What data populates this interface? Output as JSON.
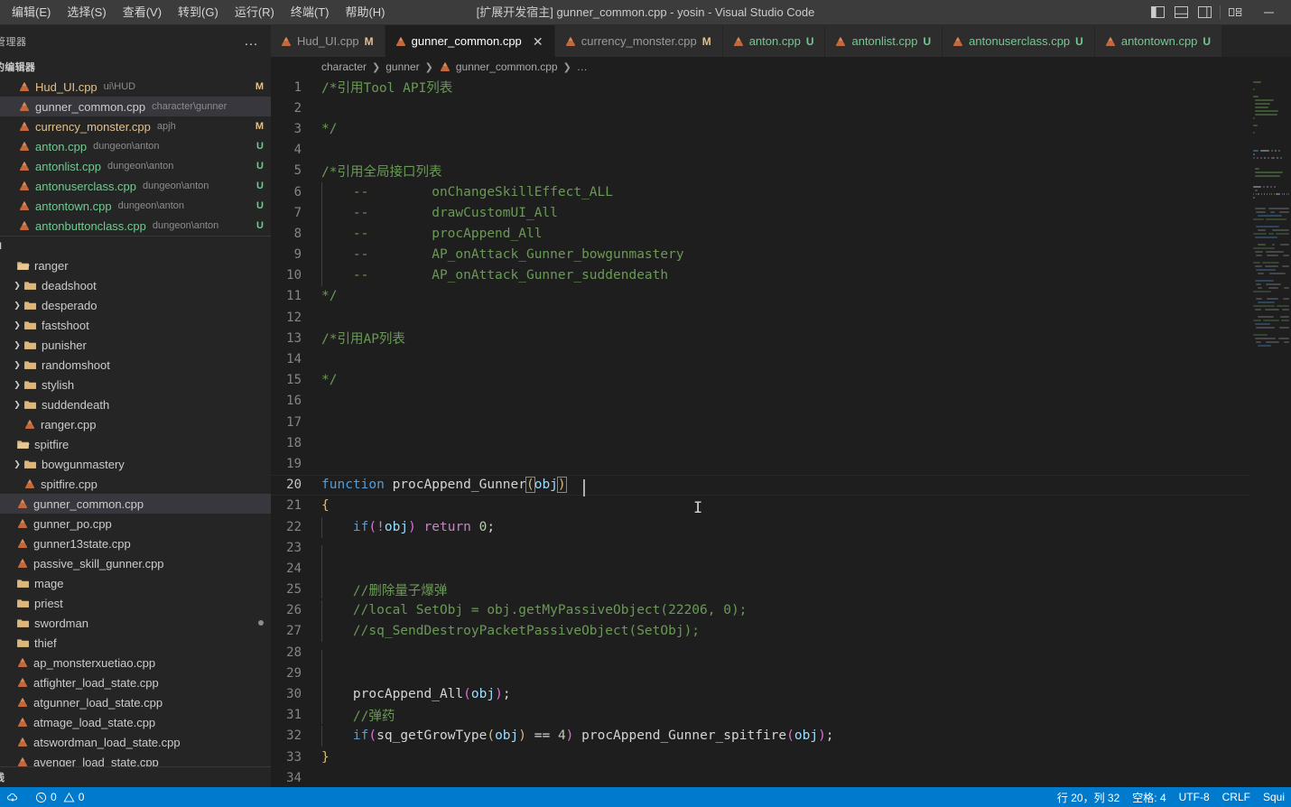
{
  "window": {
    "title": "[扩展开发宿主] gunner_common.cpp - yosin - Visual Studio Code",
    "minimize_label": "—"
  },
  "menubar": {
    "items": [
      {
        "label": "编辑(E)",
        "name": "menu-edit"
      },
      {
        "label": "选择(S)",
        "name": "menu-select"
      },
      {
        "label": "查看(V)",
        "name": "menu-view"
      },
      {
        "label": "转到(G)",
        "name": "menu-goto"
      },
      {
        "label": "运行(R)",
        "name": "menu-run"
      },
      {
        "label": "终端(T)",
        "name": "menu-terminal"
      },
      {
        "label": "帮助(H)",
        "name": "menu-help"
      }
    ]
  },
  "layout_controls": [
    {
      "name": "toggle-primary-sidebar-icon",
      "title": "切换主侧栏"
    },
    {
      "name": "toggle-panel-icon",
      "title": "切换面板"
    },
    {
      "name": "toggle-secondary-sidebar-icon",
      "title": "切换辅助侧栏"
    },
    {
      "name": "customize-layout-icon",
      "title": "自定义布局"
    }
  ],
  "sidebar": {
    "title": "管理器",
    "more_actions": "…",
    "open_editors_header": "的编辑器",
    "open_editors": [
      {
        "name": "Hud_UI.cpp",
        "path": "ui\\HUD",
        "badge": "M",
        "state": "modified",
        "selected": false
      },
      {
        "name": "gunner_common.cpp",
        "path": "character\\gunner",
        "badge": "",
        "state": "normal",
        "selected": true
      },
      {
        "name": "currency_monster.cpp",
        "path": "apjh",
        "badge": "M",
        "state": "modified",
        "selected": false
      },
      {
        "name": "anton.cpp",
        "path": "dungeon\\anton",
        "badge": "U",
        "state": "untracked",
        "selected": false
      },
      {
        "name": "antonlist.cpp",
        "path": "dungeon\\anton",
        "badge": "U",
        "state": "untracked",
        "selected": false
      },
      {
        "name": "antonuserclass.cpp",
        "path": "dungeon\\anton",
        "badge": "U",
        "state": "untracked",
        "selected": false
      },
      {
        "name": "antontown.cpp",
        "path": "dungeon\\anton",
        "badge": "U",
        "state": "untracked",
        "selected": false
      },
      {
        "name": "antonbuttonclass.cpp",
        "path": "dungeon\\anton",
        "badge": "U",
        "state": "untracked",
        "selected": false
      }
    ],
    "project_header": "N",
    "tree": [
      {
        "label": "ranger",
        "type": "folder",
        "expanded": true,
        "indent": 0
      },
      {
        "label": "deadshoot",
        "type": "folder",
        "expanded": false,
        "indent": 1
      },
      {
        "label": "desperado",
        "type": "folder",
        "expanded": false,
        "indent": 1
      },
      {
        "label": "fastshoot",
        "type": "folder",
        "expanded": false,
        "indent": 1
      },
      {
        "label": "punisher",
        "type": "folder",
        "expanded": false,
        "indent": 1
      },
      {
        "label": "randomshoot",
        "type": "folder",
        "expanded": false,
        "indent": 1
      },
      {
        "label": "stylish",
        "type": "folder",
        "expanded": false,
        "indent": 1
      },
      {
        "label": "suddendeath",
        "type": "folder",
        "expanded": false,
        "indent": 1
      },
      {
        "label": "ranger.cpp",
        "type": "file",
        "indent": 1
      },
      {
        "label": "spitfire",
        "type": "folder",
        "expanded": true,
        "indent": 0
      },
      {
        "label": "bowgunmastery",
        "type": "folder",
        "expanded": false,
        "indent": 1
      },
      {
        "label": "spitfire.cpp",
        "type": "file",
        "indent": 1
      },
      {
        "label": "gunner_common.cpp",
        "type": "file",
        "indent": 0,
        "selected": true
      },
      {
        "label": "gunner_po.cpp",
        "type": "file",
        "indent": 0
      },
      {
        "label": "gunner13state.cpp",
        "type": "file",
        "indent": 0
      },
      {
        "label": "passive_skill_gunner.cpp",
        "type": "file",
        "indent": 0
      },
      {
        "label": "mage",
        "type": "folder",
        "expanded": false,
        "indent": 0,
        "no_twisty": true
      },
      {
        "label": "priest",
        "type": "folder",
        "expanded": false,
        "indent": 0,
        "no_twisty": true
      },
      {
        "label": "swordman",
        "type": "folder",
        "expanded": false,
        "indent": 0,
        "no_twisty": true,
        "dot": true
      },
      {
        "label": "thief",
        "type": "folder",
        "expanded": false,
        "indent": 0,
        "no_twisty": true
      },
      {
        "label": "ap_monsterxuetiao.cpp",
        "type": "file",
        "indent": 0
      },
      {
        "label": "atfighter_load_state.cpp",
        "type": "file",
        "indent": 0
      },
      {
        "label": "atgunner_load_state.cpp",
        "type": "file",
        "indent": 0
      },
      {
        "label": "atmage_load_state.cpp",
        "type": "file",
        "indent": 0
      },
      {
        "label": "atswordman_load_state.cpp",
        "type": "file",
        "indent": 0
      },
      {
        "label": "avenger_load_state.cpp",
        "type": "file",
        "indent": 0
      }
    ],
    "bottom_header": "线"
  },
  "tabs": [
    {
      "label": "Hud_UI.cpp",
      "badge": "M",
      "state": "modified",
      "active": false,
      "closable": false
    },
    {
      "label": "gunner_common.cpp",
      "badge": "",
      "state": "normal",
      "active": true,
      "closable": true,
      "close": "✕"
    },
    {
      "label": "currency_monster.cpp",
      "badge": "M",
      "state": "modified",
      "active": false,
      "closable": false
    },
    {
      "label": "anton.cpp",
      "badge": "U",
      "state": "untracked",
      "active": false,
      "closable": false
    },
    {
      "label": "antonlist.cpp",
      "badge": "U",
      "state": "untracked",
      "active": false,
      "closable": false
    },
    {
      "label": "antonuserclass.cpp",
      "badge": "U",
      "state": "untracked",
      "active": false,
      "closable": false
    },
    {
      "label": "antontown.cpp",
      "badge": "U",
      "state": "untracked",
      "active": false,
      "closable": false
    }
  ],
  "breadcrumb": [
    "character",
    "gunner",
    "gunner_common.cpp",
    "…"
  ],
  "editor": {
    "current_line": 20,
    "lines": [
      {
        "n": 1,
        "tokens": [
          {
            "t": "/*引用Tool API列表",
            "c": "c-com"
          }
        ]
      },
      {
        "n": 2,
        "tokens": []
      },
      {
        "n": 3,
        "tokens": [
          {
            "t": "*/",
            "c": "c-com"
          }
        ]
      },
      {
        "n": 4,
        "tokens": []
      },
      {
        "n": 5,
        "tokens": [
          {
            "t": "/*引用全局接口列表",
            "c": "c-com"
          }
        ]
      },
      {
        "n": 6,
        "guide": true,
        "tokens": [
          {
            "t": "    --        onChangeSkillEffect_ALL",
            "c": "c-com"
          }
        ]
      },
      {
        "n": 7,
        "guide": true,
        "tokens": [
          {
            "t": "    --        drawCustomUI_All",
            "c": "c-com"
          }
        ]
      },
      {
        "n": 8,
        "guide": true,
        "tokens": [
          {
            "t": "    --        procAppend_All",
            "c": "c-com"
          }
        ]
      },
      {
        "n": 9,
        "guide": true,
        "tokens": [
          {
            "t": "    --        AP_onAttack_Gunner_bowgunmastery",
            "c": "c-com"
          }
        ]
      },
      {
        "n": 10,
        "guide": true,
        "tokens": [
          {
            "t": "    --        AP_onAttack_Gunner_suddendeath",
            "c": "c-com"
          }
        ]
      },
      {
        "n": 11,
        "tokens": [
          {
            "t": "*/",
            "c": "c-com"
          }
        ]
      },
      {
        "n": 12,
        "tokens": []
      },
      {
        "n": 13,
        "tokens": [
          {
            "t": "/*引用AP列表",
            "c": "c-com"
          }
        ]
      },
      {
        "n": 14,
        "tokens": []
      },
      {
        "n": 15,
        "tokens": [
          {
            "t": "*/",
            "c": "c-com"
          }
        ]
      },
      {
        "n": 16,
        "tokens": []
      },
      {
        "n": 17,
        "tokens": []
      },
      {
        "n": 18,
        "tokens": []
      },
      {
        "n": 19,
        "tokens": []
      },
      {
        "n": 20,
        "current": true,
        "tokens": [
          {
            "t": "function ",
            "c": "c-kw"
          },
          {
            "t": "procAppend_Gunner",
            "c": "c-white"
          },
          {
            "t": "(",
            "c": "c-brace",
            "match": true
          },
          {
            "t": "obj",
            "c": "c-var"
          },
          {
            "t": ")",
            "c": "c-brace",
            "match": true
          }
        ]
      },
      {
        "n": 21,
        "tokens": [
          {
            "t": "{",
            "c": "c-brace"
          }
        ]
      },
      {
        "n": 22,
        "guide": true,
        "tokens": [
          {
            "t": "    ",
            "c": "c-plain"
          },
          {
            "t": "if",
            "c": "c-kw"
          },
          {
            "t": "(",
            "c": "c-brace2"
          },
          {
            "t": "!",
            "c": "c-ctrl"
          },
          {
            "t": "obj",
            "c": "c-var"
          },
          {
            "t": ")",
            "c": "c-brace2"
          },
          {
            "t": " ",
            "c": "c-plain"
          },
          {
            "t": "return",
            "c": "c-ctrl"
          },
          {
            "t": " ",
            "c": "c-plain"
          },
          {
            "t": "0",
            "c": "c-num"
          },
          {
            "t": ";",
            "c": "c-plain"
          }
        ]
      },
      {
        "n": 23,
        "guide": true,
        "tokens": []
      },
      {
        "n": 24,
        "guide": true,
        "tokens": []
      },
      {
        "n": 25,
        "guide": true,
        "tokens": [
          {
            "t": "    //删除量子爆弹",
            "c": "c-com"
          }
        ]
      },
      {
        "n": 26,
        "guide": true,
        "tokens": [
          {
            "t": "    //local SetObj = obj.getMyPassiveObject(22206, 0);",
            "c": "c-com"
          }
        ]
      },
      {
        "n": 27,
        "guide": true,
        "tokens": [
          {
            "t": "    //sq_SendDestroyPacketPassiveObject(SetObj);",
            "c": "c-com"
          }
        ]
      },
      {
        "n": 28,
        "guide": true,
        "tokens": []
      },
      {
        "n": 29,
        "guide": true,
        "tokens": []
      },
      {
        "n": 30,
        "guide": true,
        "tokens": [
          {
            "t": "    ",
            "c": "c-plain"
          },
          {
            "t": "procAppend_All",
            "c": "c-white"
          },
          {
            "t": "(",
            "c": "c-brace2"
          },
          {
            "t": "obj",
            "c": "c-var"
          },
          {
            "t": ")",
            "c": "c-brace2"
          },
          {
            "t": ";",
            "c": "c-plain"
          }
        ]
      },
      {
        "n": 31,
        "guide": true,
        "tokens": [
          {
            "t": "    //弹药",
            "c": "c-com"
          }
        ]
      },
      {
        "n": 32,
        "guide": true,
        "tokens": [
          {
            "t": "    ",
            "c": "c-plain"
          },
          {
            "t": "if",
            "c": "c-kw"
          },
          {
            "t": "(",
            "c": "c-brace2"
          },
          {
            "t": "sq_getGrowType",
            "c": "c-white"
          },
          {
            "t": "(",
            "c": "c-brace"
          },
          {
            "t": "obj",
            "c": "c-var"
          },
          {
            "t": ")",
            "c": "c-brace"
          },
          {
            "t": " == ",
            "c": "c-plain"
          },
          {
            "t": "4",
            "c": "c-num"
          },
          {
            "t": ")",
            "c": "c-brace2"
          },
          {
            "t": " ",
            "c": "c-plain"
          },
          {
            "t": "procAppend_Gunner_spitfire",
            "c": "c-white"
          },
          {
            "t": "(",
            "c": "c-brace2"
          },
          {
            "t": "obj",
            "c": "c-var"
          },
          {
            "t": ")",
            "c": "c-brace2"
          },
          {
            "t": ";",
            "c": "c-plain"
          }
        ]
      },
      {
        "n": 33,
        "tokens": [
          {
            "t": "}",
            "c": "c-brace"
          }
        ]
      },
      {
        "n": 34,
        "tokens": []
      }
    ]
  },
  "statusbar": {
    "left": [
      {
        "name": "remote-indicator",
        "icon": "remote-icon",
        "label": ""
      },
      {
        "name": "problems-errors",
        "icon": "error-icon",
        "label": "0",
        "icon2": "warning-icon",
        "label2": "0"
      }
    ],
    "right": [
      {
        "name": "editor-position",
        "label": "行 20，列 32"
      },
      {
        "name": "editor-indentation",
        "label": "空格: 4"
      },
      {
        "name": "editor-encoding",
        "label": "UTF-8"
      },
      {
        "name": "editor-eol",
        "label": "CRLF"
      },
      {
        "name": "editor-language",
        "label": "Squi"
      }
    ]
  },
  "colors": {
    "accent": "#007acc",
    "titlebar": "#3c3c3c",
    "sidebar": "#252526",
    "editor": "#1e1e1e",
    "modified": "#e2c08d",
    "untracked": "#73c991"
  }
}
